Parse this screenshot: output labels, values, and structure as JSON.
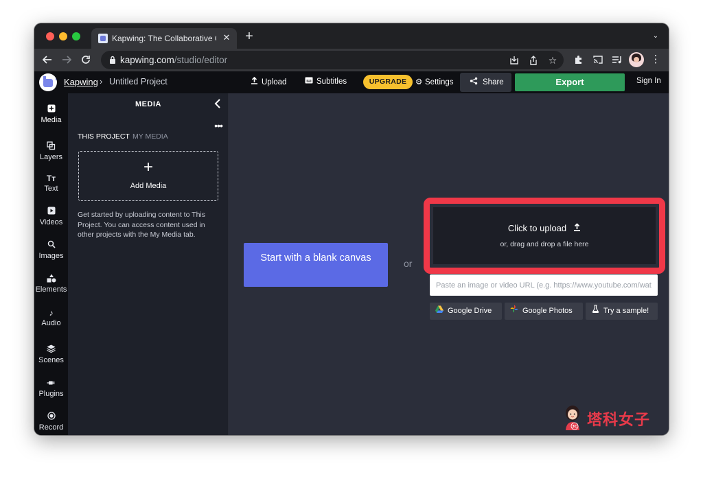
{
  "browser": {
    "tab_title": "Kapwing: The Collaborative Online Video Editor",
    "tab_close": "✕",
    "new_tab": "+",
    "tab_menu": "⌄",
    "url_host": "kapwing.com",
    "url_path": "/studio/editor",
    "icons": [
      "back-arrow-icon",
      "forward-arrow-icon",
      "reload-icon",
      "lock-icon",
      "install-icon",
      "share-icon",
      "star-icon",
      "extensions-icon",
      "cast-icon",
      "media-icon",
      "kebab-menu-icon"
    ]
  },
  "header": {
    "brand": "Kapwing",
    "separator": "›",
    "project_name": "Untitled Project",
    "upload_label": "Upload",
    "subtitles_label": "Subtitles",
    "upgrade_label": "UPGRADE",
    "settings_label": "Settings",
    "share_label": "Share",
    "export_label": "Export",
    "signin_label": "Sign In",
    "colors": {
      "upgrade": "#f7c12e",
      "export": "#2e9a5a",
      "bar": "#0e0f13"
    }
  },
  "rail": {
    "items": [
      {
        "label": "Media",
        "icon": "media-plus-icon"
      },
      {
        "label": "Layers",
        "icon": "layers-icon"
      },
      {
        "label": "Text",
        "icon": "text-icon"
      },
      {
        "label": "Videos",
        "icon": "video-icon"
      },
      {
        "label": "Images",
        "icon": "search-icon"
      },
      {
        "label": "Elements",
        "icon": "shapes-icon"
      },
      {
        "label": "Audio",
        "icon": "music-note-icon"
      },
      {
        "label": "Scenes",
        "icon": "scenes-icon"
      },
      {
        "label": "Plugins",
        "icon": "plugin-icon"
      },
      {
        "label": "Record",
        "icon": "record-icon"
      }
    ]
  },
  "panel": {
    "title": "MEDIA",
    "more": "•••",
    "tab_project": "THIS PROJECT",
    "tab_my_media": "MY MEDIA",
    "add_label": "Add Media",
    "help_text": "Get started by uploading content to This Project. You can access content used in other projects with the My Media tab."
  },
  "main": {
    "blank_canvas_label": "Start with a blank canvas",
    "or_label": "or",
    "upload_title": "Click to upload",
    "upload_sub": "or, drag and drop a file here",
    "url_placeholder": "Paste an image or video URL (e.g. https://www.youtube.com/watch?v=...)",
    "google_drive_label": "Google Drive",
    "google_photos_label": "Google Photos",
    "sample_label": "Try a sample!",
    "colors": {
      "blank_button": "#5b6ae5",
      "highlight": "#f03848",
      "canvas_bg": "#2b2e3a"
    }
  },
  "watermark": {
    "text": "塔科女子",
    "badge": "3C"
  }
}
